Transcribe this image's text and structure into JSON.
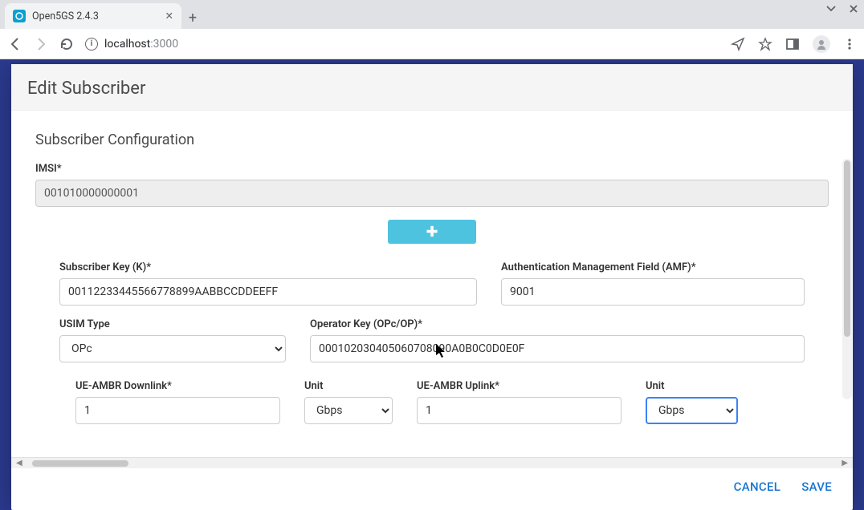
{
  "browser": {
    "tab_title": "Open5GS 2.4.3",
    "url_host": "localhost",
    "url_port": ":3000"
  },
  "modal": {
    "title": "Edit Subscriber",
    "section_title": "Subscriber Configuration"
  },
  "labels": {
    "imsi": "IMSI*",
    "key": "Subscriber Key (K)*",
    "amf": "Authentication Management Field (AMF)*",
    "usim_type": "USIM Type",
    "op_key": "Operator Key (OPc/OP)*",
    "ambr_dl": "UE-AMBR Downlink*",
    "unit1": "Unit",
    "ambr_ul": "UE-AMBR Uplink*",
    "unit2": "Unit"
  },
  "values": {
    "imsi": "001010000000001",
    "key": "00112233445566778899AABBCCDDEEFF",
    "amf": "9001",
    "usim_type": "OPc",
    "op_key": "000102030405060708090A0B0C0D0E0F",
    "ambr_dl": "1",
    "unit1": "Gbps",
    "ambr_ul": "1",
    "unit2": "Gbps"
  },
  "footer": {
    "cancel": "CANCEL",
    "save": "SAVE"
  }
}
